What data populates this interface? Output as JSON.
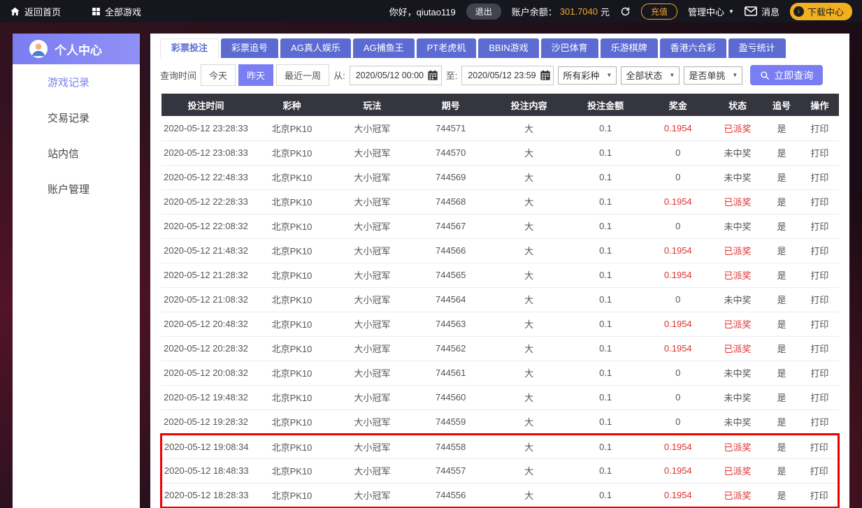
{
  "colors": {
    "accent_purple": "#7b7ef2",
    "tab_blue": "#5c6bd2",
    "balance_orange": "#f5a623",
    "win_red": "#e03030",
    "annotation_red": "#ee0000",
    "table_header_bg": "#35353f"
  },
  "icons": {
    "chevron_down": "▼",
    "download_arrow": "↓"
  },
  "topbar": {
    "home_label": "返回首页",
    "all_games_label": "全部游戏",
    "greeting": "你好，qiutao119",
    "logout_label": "退出",
    "balance_label": "账户余额：",
    "balance_value": "301.7040",
    "balance_unit": "元",
    "recharge_label": "充值",
    "admin_label": "管理中心",
    "messages_label": "消息",
    "download_label": "下载中心"
  },
  "sidebar": {
    "title": "个人中心",
    "items": [
      {
        "label": "游戏记录",
        "active": true
      },
      {
        "label": "交易记录",
        "active": false
      },
      {
        "label": "站内信",
        "active": false
      },
      {
        "label": "账户管理",
        "active": false
      }
    ]
  },
  "tabs": [
    {
      "label": "彩票投注",
      "active": true
    },
    {
      "label": "彩票追号",
      "active": false
    },
    {
      "label": "AG真人娱乐",
      "active": false
    },
    {
      "label": "AG捕鱼王",
      "active": false
    },
    {
      "label": "PT老虎机",
      "active": false
    },
    {
      "label": "BBIN游戏",
      "active": false
    },
    {
      "label": "沙巴体育",
      "active": false
    },
    {
      "label": "乐游棋牌",
      "active": false
    },
    {
      "label": "香港六合彩",
      "active": false
    },
    {
      "label": "盈亏统计",
      "active": false
    }
  ],
  "filters": {
    "time_label": "查询时间",
    "quick_ranges": [
      {
        "label": "今天",
        "active": false
      },
      {
        "label": "昨天",
        "active": true
      },
      {
        "label": "最近一周",
        "active": false
      }
    ],
    "from_label": "从:",
    "from_value": "2020/05/12 00:00",
    "to_label": "至:",
    "to_value": "2020/05/12 23:59",
    "lottery_type_selected": "所有彩种",
    "status_selected": "全部状态",
    "single_pick_selected": "是否单挑",
    "query_label": "立即查询"
  },
  "table": {
    "columns": [
      "投注时间",
      "彩种",
      "玩法",
      "期号",
      "投注内容",
      "投注金额",
      "奖金",
      "状态",
      "追号",
      "操作"
    ],
    "rows": [
      {
        "time": "2020-05-12 23:28:33",
        "lottery": "北京PK10",
        "play": "大小冠军",
        "issue": "744571",
        "content": "大",
        "amount": "0.1",
        "prize": "0.1954",
        "status": "已派奖",
        "chase": "是",
        "action": "打印",
        "won": true,
        "highlighted": false
      },
      {
        "time": "2020-05-12 23:08:33",
        "lottery": "北京PK10",
        "play": "大小冠军",
        "issue": "744570",
        "content": "大",
        "amount": "0.1",
        "prize": "0",
        "status": "未中奖",
        "chase": "是",
        "action": "打印",
        "won": false,
        "highlighted": false
      },
      {
        "time": "2020-05-12 22:48:33",
        "lottery": "北京PK10",
        "play": "大小冠军",
        "issue": "744569",
        "content": "大",
        "amount": "0.1",
        "prize": "0",
        "status": "未中奖",
        "chase": "是",
        "action": "打印",
        "won": false,
        "highlighted": false
      },
      {
        "time": "2020-05-12 22:28:33",
        "lottery": "北京PK10",
        "play": "大小冠军",
        "issue": "744568",
        "content": "大",
        "amount": "0.1",
        "prize": "0.1954",
        "status": "已派奖",
        "chase": "是",
        "action": "打印",
        "won": true,
        "highlighted": false
      },
      {
        "time": "2020-05-12 22:08:32",
        "lottery": "北京PK10",
        "play": "大小冠军",
        "issue": "744567",
        "content": "大",
        "amount": "0.1",
        "prize": "0",
        "status": "未中奖",
        "chase": "是",
        "action": "打印",
        "won": false,
        "highlighted": false
      },
      {
        "time": "2020-05-12 21:48:32",
        "lottery": "北京PK10",
        "play": "大小冠军",
        "issue": "744566",
        "content": "大",
        "amount": "0.1",
        "prize": "0.1954",
        "status": "已派奖",
        "chase": "是",
        "action": "打印",
        "won": true,
        "highlighted": false
      },
      {
        "time": "2020-05-12 21:28:32",
        "lottery": "北京PK10",
        "play": "大小冠军",
        "issue": "744565",
        "content": "大",
        "amount": "0.1",
        "prize": "0.1954",
        "status": "已派奖",
        "chase": "是",
        "action": "打印",
        "won": true,
        "highlighted": false
      },
      {
        "time": "2020-05-12 21:08:32",
        "lottery": "北京PK10",
        "play": "大小冠军",
        "issue": "744564",
        "content": "大",
        "amount": "0.1",
        "prize": "0",
        "status": "未中奖",
        "chase": "是",
        "action": "打印",
        "won": false,
        "highlighted": false
      },
      {
        "time": "2020-05-12 20:48:32",
        "lottery": "北京PK10",
        "play": "大小冠军",
        "issue": "744563",
        "content": "大",
        "amount": "0.1",
        "prize": "0.1954",
        "status": "已派奖",
        "chase": "是",
        "action": "打印",
        "won": true,
        "highlighted": false
      },
      {
        "time": "2020-05-12 20:28:32",
        "lottery": "北京PK10",
        "play": "大小冠军",
        "issue": "744562",
        "content": "大",
        "amount": "0.1",
        "prize": "0.1954",
        "status": "已派奖",
        "chase": "是",
        "action": "打印",
        "won": true,
        "highlighted": false
      },
      {
        "time": "2020-05-12 20:08:32",
        "lottery": "北京PK10",
        "play": "大小冠军",
        "issue": "744561",
        "content": "大",
        "amount": "0.1",
        "prize": "0",
        "status": "未中奖",
        "chase": "是",
        "action": "打印",
        "won": false,
        "highlighted": false
      },
      {
        "time": "2020-05-12 19:48:32",
        "lottery": "北京PK10",
        "play": "大小冠军",
        "issue": "744560",
        "content": "大",
        "amount": "0.1",
        "prize": "0",
        "status": "未中奖",
        "chase": "是",
        "action": "打印",
        "won": false,
        "highlighted": false
      },
      {
        "time": "2020-05-12 19:28:32",
        "lottery": "北京PK10",
        "play": "大小冠军",
        "issue": "744559",
        "content": "大",
        "amount": "0.1",
        "prize": "0",
        "status": "未中奖",
        "chase": "是",
        "action": "打印",
        "won": false,
        "highlighted": false
      },
      {
        "time": "2020-05-12 19:08:34",
        "lottery": "北京PK10",
        "play": "大小冠军",
        "issue": "744558",
        "content": "大",
        "amount": "0.1",
        "prize": "0.1954",
        "status": "已派奖",
        "chase": "是",
        "action": "打印",
        "won": true,
        "highlighted": true
      },
      {
        "time": "2020-05-12 18:48:33",
        "lottery": "北京PK10",
        "play": "大小冠军",
        "issue": "744557",
        "content": "大",
        "amount": "0.1",
        "prize": "0.1954",
        "status": "已派奖",
        "chase": "是",
        "action": "打印",
        "won": true,
        "highlighted": true
      },
      {
        "time": "2020-05-12 18:28:33",
        "lottery": "北京PK10",
        "play": "大小冠军",
        "issue": "744556",
        "content": "大",
        "amount": "0.1",
        "prize": "0.1954",
        "status": "已派奖",
        "chase": "是",
        "action": "打印",
        "won": true,
        "highlighted": true
      }
    ]
  }
}
